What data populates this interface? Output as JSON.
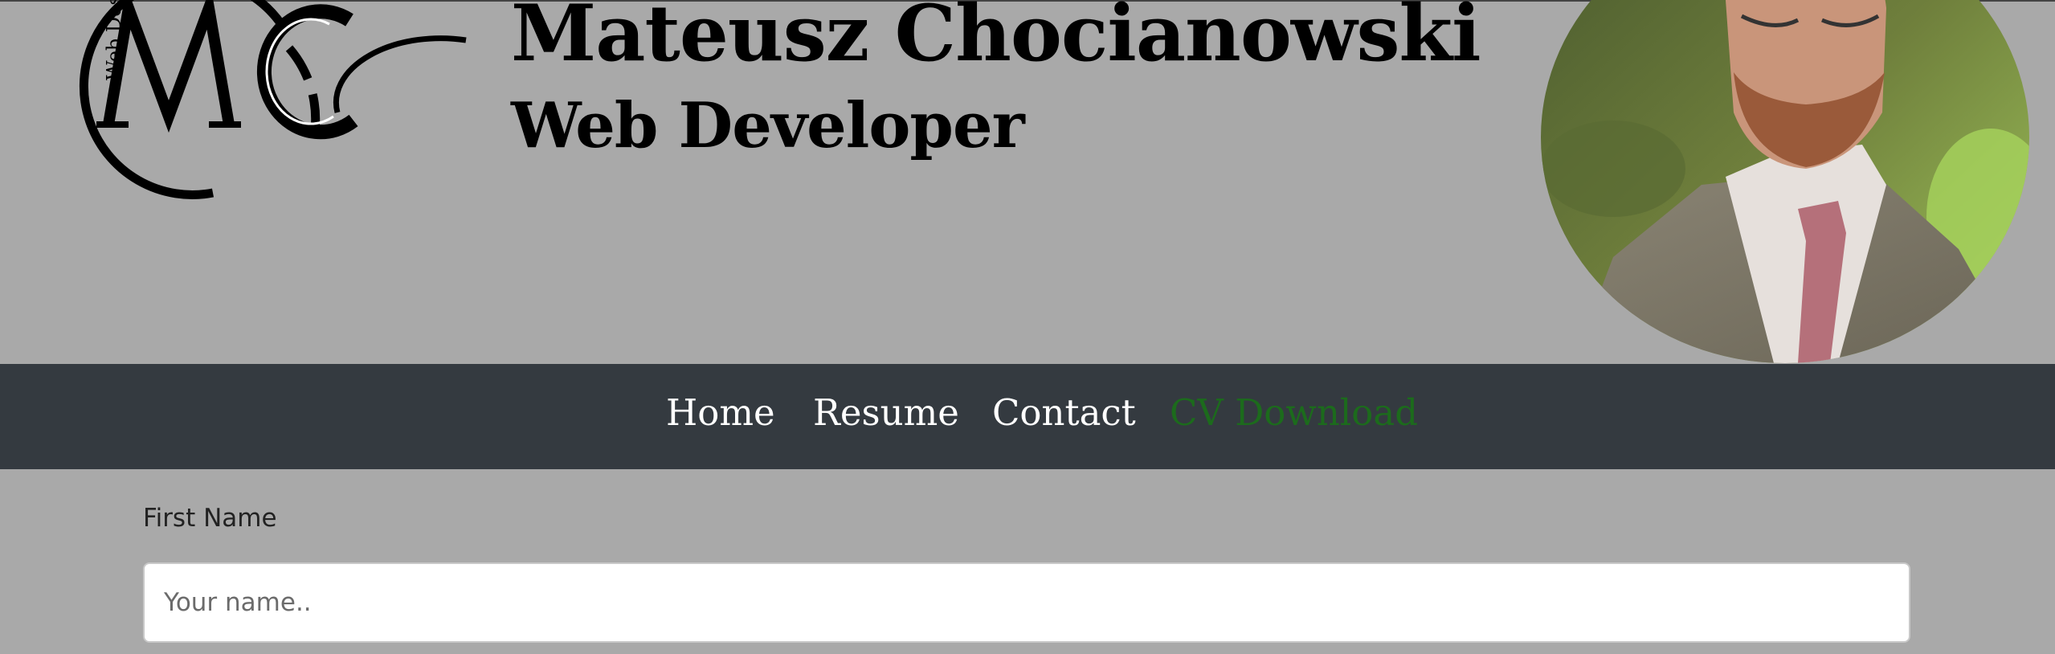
{
  "header": {
    "logo": {
      "monogram": "MC",
      "side_text": "Web Desi"
    },
    "name": "Mateusz Chocianowski",
    "role": "Web Developer",
    "portrait_alt": "Portrait photo"
  },
  "nav": {
    "items": [
      {
        "label": "Home"
      },
      {
        "label": "Resume"
      },
      {
        "label": "Contact"
      },
      {
        "label": "CV Download"
      }
    ],
    "highlight_color": "#1c6b1c"
  },
  "form": {
    "first_name": {
      "label": "First Name",
      "placeholder": "Your name..",
      "value": ""
    }
  }
}
